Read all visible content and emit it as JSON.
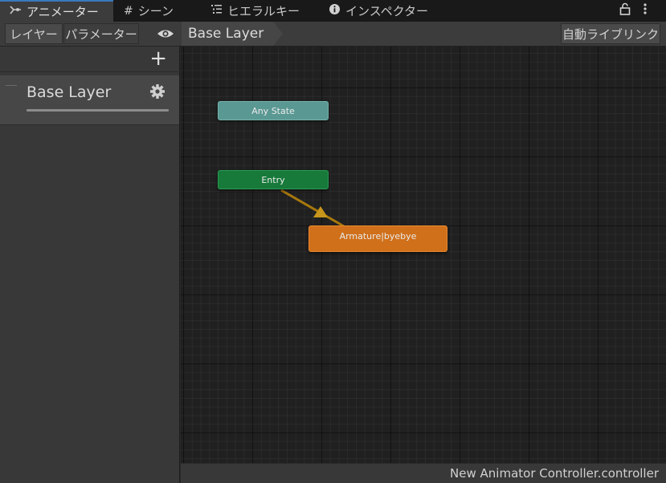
{
  "tabs": [
    {
      "label": "アニメーター",
      "icon": "animator-icon",
      "active": true
    },
    {
      "label": "シーン",
      "icon": "scene-grid-icon",
      "active": false
    },
    {
      "label": "ヒエラルキー",
      "icon": "hierarchy-icon",
      "active": false
    },
    {
      "label": "インスペクター",
      "icon": "info-icon",
      "active": false
    }
  ],
  "toolbar": {
    "layers_tab": "レイヤー",
    "parameters_tab": "パラメーター",
    "breadcrumb": "Base Layer",
    "auto_live_link": "自動ライブリンク"
  },
  "layers": [
    {
      "name": "Base Layer"
    }
  ],
  "states": {
    "any_state": {
      "label": "Any State",
      "color": "#5a9893"
    },
    "entry": {
      "label": "Entry",
      "color": "#177a3a"
    },
    "default_state": {
      "label": "Armature|byebye",
      "color": "#d0701a"
    }
  },
  "status": {
    "controller_name": "New Animator Controller.controller"
  },
  "colors": {
    "active_tab_accent": "#3a79bb",
    "transition": "#a8780c"
  }
}
